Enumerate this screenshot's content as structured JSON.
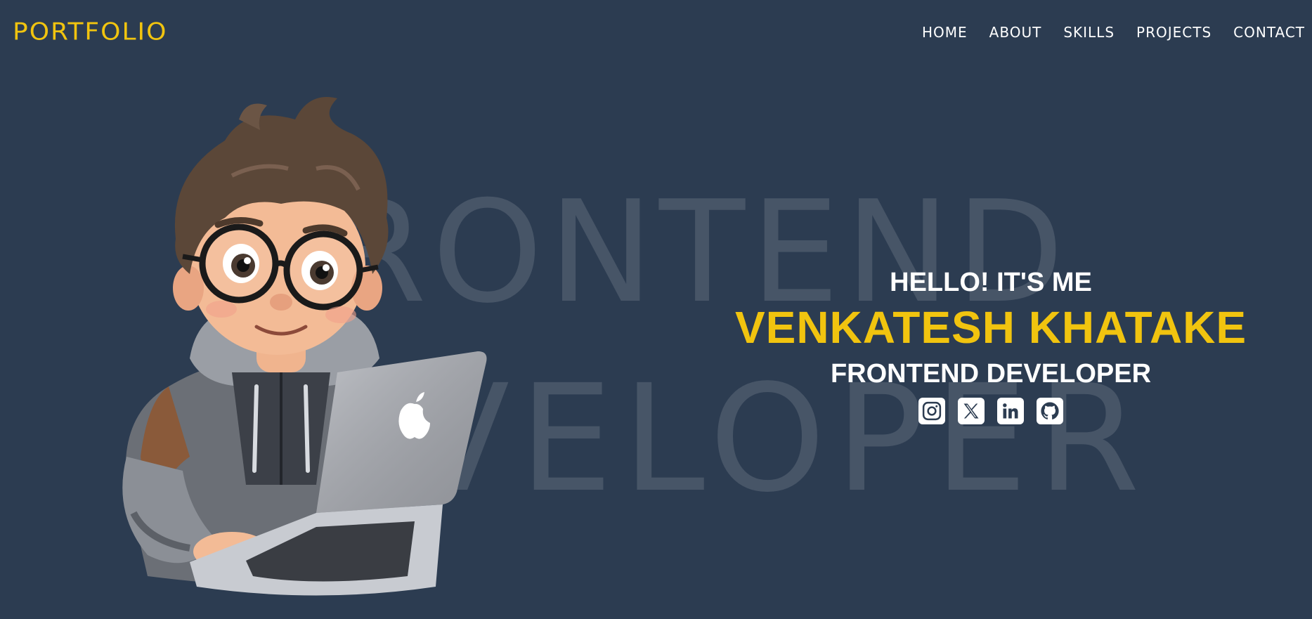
{
  "nav": {
    "logo": "PORTFOLIO",
    "links": [
      "HOME",
      "ABOUT",
      "SKILLS",
      "PROJECTS",
      "CONTACT"
    ]
  },
  "background_text": {
    "line1": "FRONTEND",
    "line2": "DEVELOPER"
  },
  "hero": {
    "greeting": "HELLO! IT'S ME",
    "name": "VENKATESH KHATAKE",
    "role": "FRONTEND DEVELOPER"
  },
  "social_icons": [
    "instagram-icon",
    "x-icon",
    "linkedin-icon",
    "github-icon"
  ],
  "colors": {
    "background": "#2c3c51",
    "accent": "#f1c40f",
    "text": "#ffffff"
  }
}
